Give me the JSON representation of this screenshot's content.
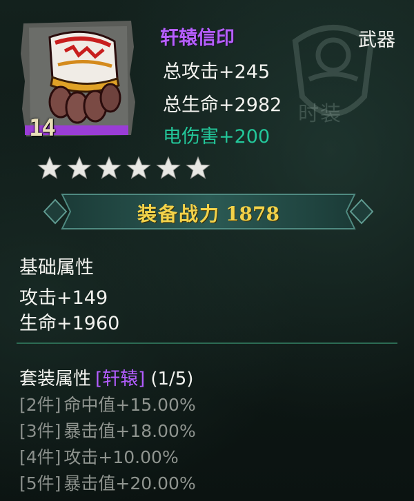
{
  "item": {
    "name": "轩辕信印",
    "type": "武器",
    "level": "14",
    "total_attack": "总攻击+245",
    "total_hp": "总生命+2982",
    "elec_damage": "电伤害+200",
    "stars": 6,
    "icon": "fist-gauntlet-icon"
  },
  "watermark": {
    "text": "时装",
    "icon": "emblem-icon"
  },
  "power": {
    "label": "装备战力",
    "value": "1878"
  },
  "base": {
    "title": "基础属性",
    "attack": "攻击+149",
    "hp": "生命+1960"
  },
  "set": {
    "title": "套装属性",
    "name": "[轩辕]",
    "count": "(1/5)",
    "bonuses": [
      {
        "tag": "[2件]",
        "text": "命中值+15.00%"
      },
      {
        "tag": "[3件]",
        "text": "暴击值+18.00%"
      },
      {
        "tag": "[4件]",
        "text": "攻击+10.00%"
      },
      {
        "tag": "[5件]",
        "text": "暴击值+20.00%"
      }
    ]
  },
  "colors": {
    "name_purple": "#b65fff",
    "elec_green": "#23c79a",
    "power_gold": "#f2d24a",
    "inactive_gray": "#8f948f",
    "divider_teal": "#2c6b54"
  }
}
